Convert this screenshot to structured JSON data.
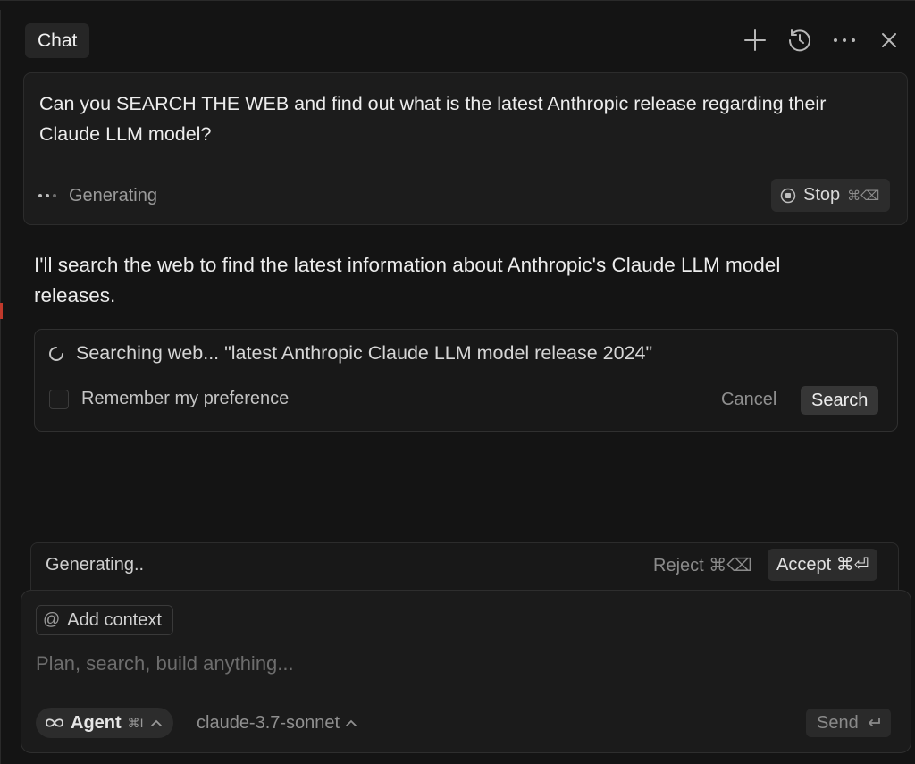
{
  "header": {
    "tab_label": "Chat",
    "icons": [
      "plus-icon",
      "history-icon",
      "more-icon",
      "close-icon"
    ]
  },
  "user_message": {
    "text": "Can you SEARCH THE WEB and find out what is the latest Anthropic release regarding their Claude LLM model?",
    "status": "Generating",
    "stop_label": "Stop",
    "stop_shortcut": "⌘⌫"
  },
  "assistant": {
    "text": "I'll search the web to find the latest information about Anthropic's Claude LLM model releases."
  },
  "search_prompt": {
    "label": "Searching web... \"latest Anthropic Claude LLM model release 2024\"",
    "remember_label": "Remember my preference",
    "cancel_label": "Cancel",
    "search_label": "Search"
  },
  "generating_bar": {
    "text": "Generating..",
    "reject_label": "Reject ⌘⌫",
    "accept_label": "Accept ⌘⏎"
  },
  "composer": {
    "add_context_label": "Add context",
    "placeholder": "Plan, search, build anything...",
    "agent_label": "Agent",
    "agent_shortcut": "⌘I",
    "model_label": "claude-3.7-sonnet",
    "send_label": "Send"
  },
  "colors": {
    "background": "#141414",
    "card": "#1c1c1c",
    "border": "#2c2c2c",
    "text": "#ececec",
    "muted": "#8f8f8f"
  }
}
